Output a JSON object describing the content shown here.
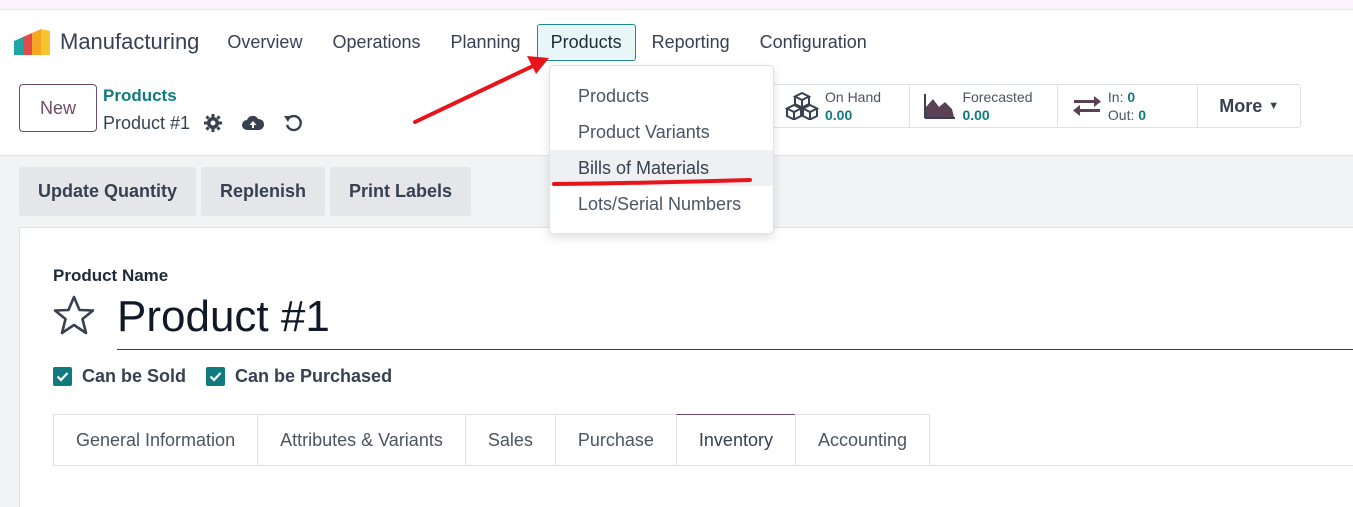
{
  "app": {
    "name": "Manufacturing"
  },
  "menu": [
    {
      "label": "Overview"
    },
    {
      "label": "Operations"
    },
    {
      "label": "Planning"
    },
    {
      "label": "Products"
    },
    {
      "label": "Reporting"
    },
    {
      "label": "Configuration"
    }
  ],
  "control": {
    "new_label": "New",
    "breadcrumb_parent": "Products",
    "breadcrumb_current": "Product #1"
  },
  "smart_buttons": {
    "on_hand_label": "On Hand",
    "on_hand_value": "0.00",
    "forecasted_label": "Forecasted",
    "forecasted_value": "0.00",
    "in_label": "In:",
    "in_value": "0",
    "out_label": "Out:",
    "out_value": "0",
    "more_label": "More"
  },
  "actions": [
    {
      "label": "Update Quantity"
    },
    {
      "label": "Replenish"
    },
    {
      "label": "Print Labels"
    }
  ],
  "form": {
    "product_name_label": "Product Name",
    "product_name": "Product #1",
    "can_be_sold": "Can be Sold",
    "can_be_purchased": "Can be Purchased"
  },
  "tabs": [
    {
      "label": "General Information"
    },
    {
      "label": "Attributes & Variants"
    },
    {
      "label": "Sales"
    },
    {
      "label": "Purchase"
    },
    {
      "label": "Inventory"
    },
    {
      "label": "Accounting"
    }
  ],
  "dropdown": [
    {
      "label": "Products"
    },
    {
      "label": "Product Variants"
    },
    {
      "label": "Bills of Materials"
    },
    {
      "label": "Lots/Serial Numbers"
    }
  ],
  "colors": {
    "brand_purple": "#714b67",
    "teal": "#117a7e",
    "annotation_red": "#e8141b"
  }
}
